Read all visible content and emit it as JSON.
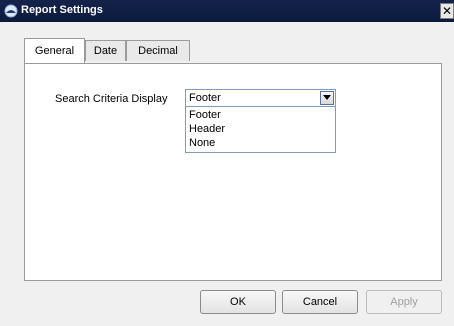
{
  "window": {
    "title": "Report Settings",
    "close_glyph": "✕",
    "icon": "app-icon"
  },
  "tabs": [
    {
      "label": "General",
      "active": true
    },
    {
      "label": "Date",
      "active": false
    },
    {
      "label": "Decimal",
      "active": false
    }
  ],
  "general": {
    "search_criteria_label": "Search Criteria Display",
    "selected_value": "Footer",
    "options": [
      "Footer",
      "Header",
      "None"
    ]
  },
  "buttons": {
    "ok": "OK",
    "cancel": "Cancel",
    "apply": "Apply"
  },
  "colors": {
    "titlebar": "#0b1a3d",
    "focus_border": "#7f9db9"
  }
}
